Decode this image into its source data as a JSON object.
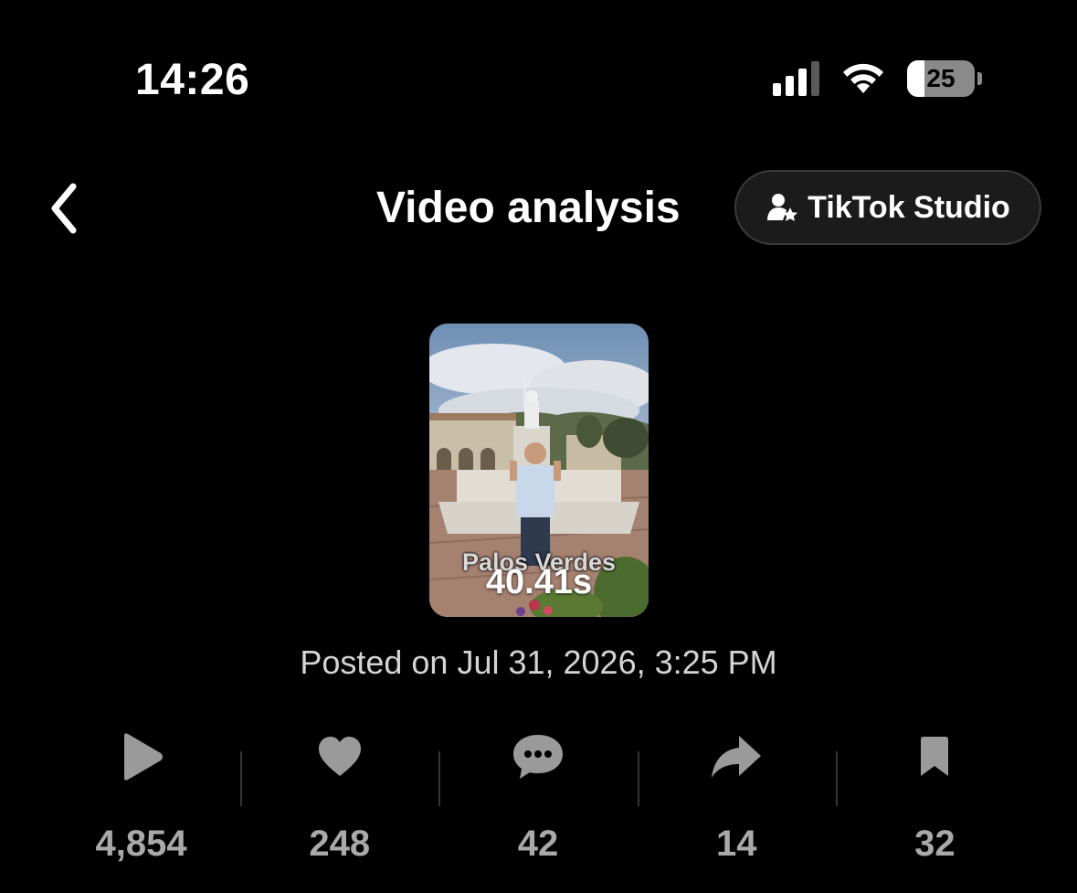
{
  "status_bar": {
    "time": "14:26",
    "battery_percent": "25",
    "battery_level": 0.25,
    "signal_bars_active": 3,
    "signal_bars_total": 4,
    "icons": [
      "cellular-signal-icon",
      "wifi-icon",
      "battery-icon"
    ]
  },
  "header": {
    "title": "Video analysis",
    "studio_button_label": "TikTok Studio",
    "back_icon": "chevron-left-icon",
    "studio_icon": "user-star-icon"
  },
  "video": {
    "caption_overlay": "Palos Verdes",
    "duration": "40.41s",
    "posted": "Posted on Jul 31, 2026, 3:25 PM"
  },
  "stats": [
    {
      "icon": "play-icon",
      "value": "4,854"
    },
    {
      "icon": "heart-icon",
      "value": "248"
    },
    {
      "icon": "comment-icon",
      "value": "42"
    },
    {
      "icon": "share-icon",
      "value": "14"
    },
    {
      "icon": "bookmark-icon",
      "value": "32"
    }
  ],
  "colors": {
    "background": "#000000",
    "text_primary": "#ffffff",
    "text_secondary": "#a9a9a9",
    "icon_gray": "#9a9a9a",
    "button_bg": "#1b1b1b"
  }
}
